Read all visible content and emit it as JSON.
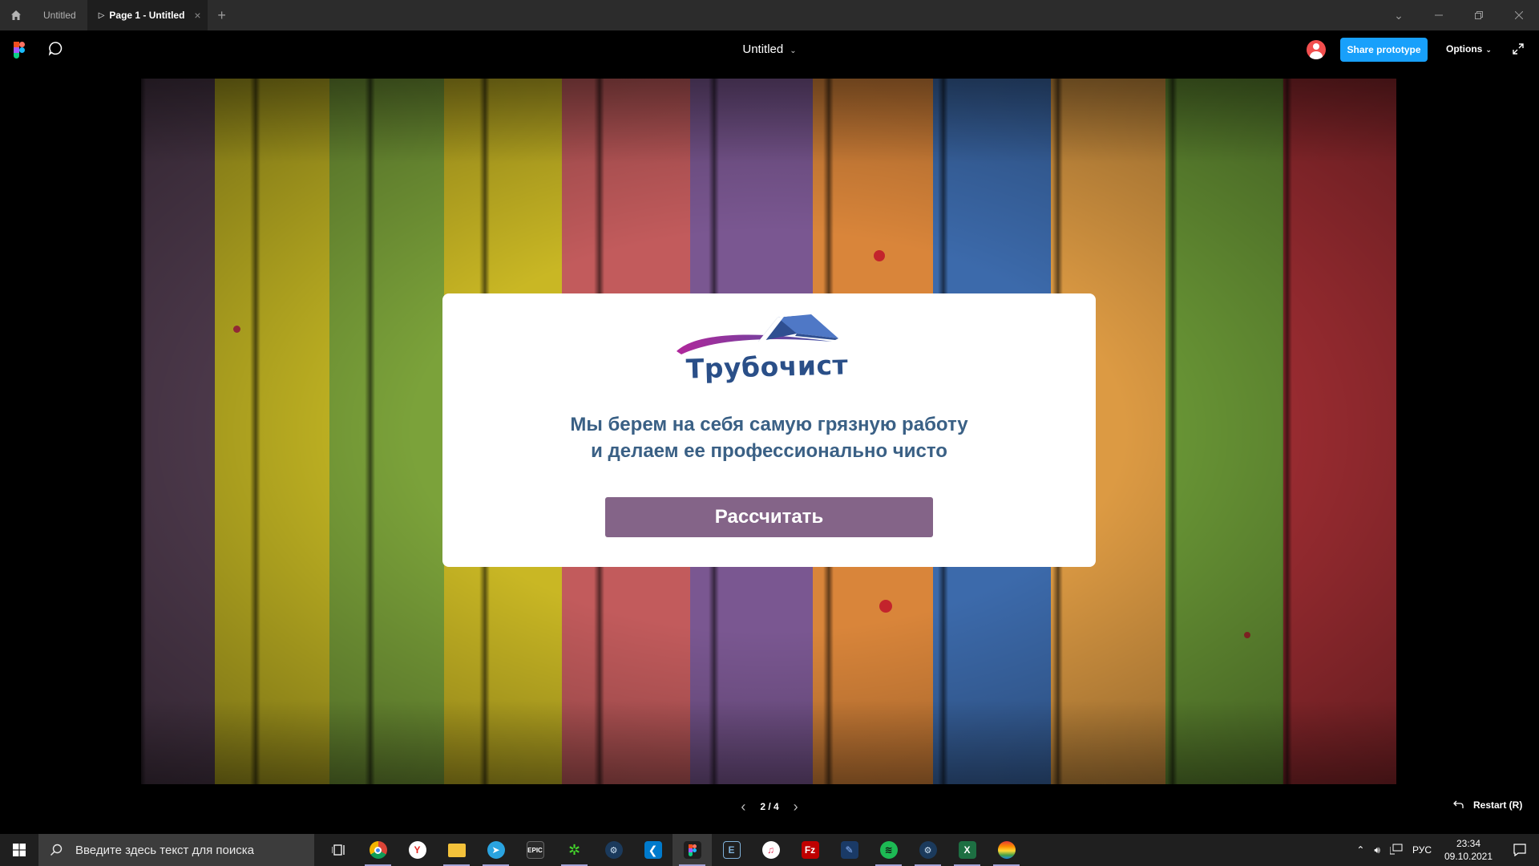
{
  "titlebar": {
    "tabs": [
      {
        "label": "Untitled",
        "active": false
      },
      {
        "label": "Page 1 - Untitled",
        "active": true
      }
    ]
  },
  "toolbar": {
    "file_title": "Untitled",
    "share_label": "Share prototype",
    "options_label": "Options"
  },
  "slide": {
    "logo_text": "Трубочист",
    "tagline_line1": "Мы берем на себя самую грязную работу",
    "tagline_line2": "и делаем ее профессионально чисто",
    "button_label": "Рассчитать"
  },
  "navigation": {
    "page_indicator": "2 / 4",
    "restart_label": "Restart (R)"
  },
  "taskbar": {
    "search_placeholder": "Введите здесь текст для поиска",
    "pinned_apps": [
      "task-view",
      "chrome",
      "yandex",
      "file-explorer",
      "telegram",
      "epic-games",
      "razer",
      "steam",
      "vscode",
      "figma",
      "terminal",
      "itunes",
      "filezilla",
      "photo-app",
      "spotify",
      "steam-2",
      "excel",
      "color-app"
    ],
    "language": "РУС",
    "time": "23:34",
    "date": "09.10.2021"
  },
  "colors": {
    "accent": "#18a0fb",
    "button": "#846488",
    "tagline": "#3a6085",
    "logo": "#2a4f88"
  }
}
